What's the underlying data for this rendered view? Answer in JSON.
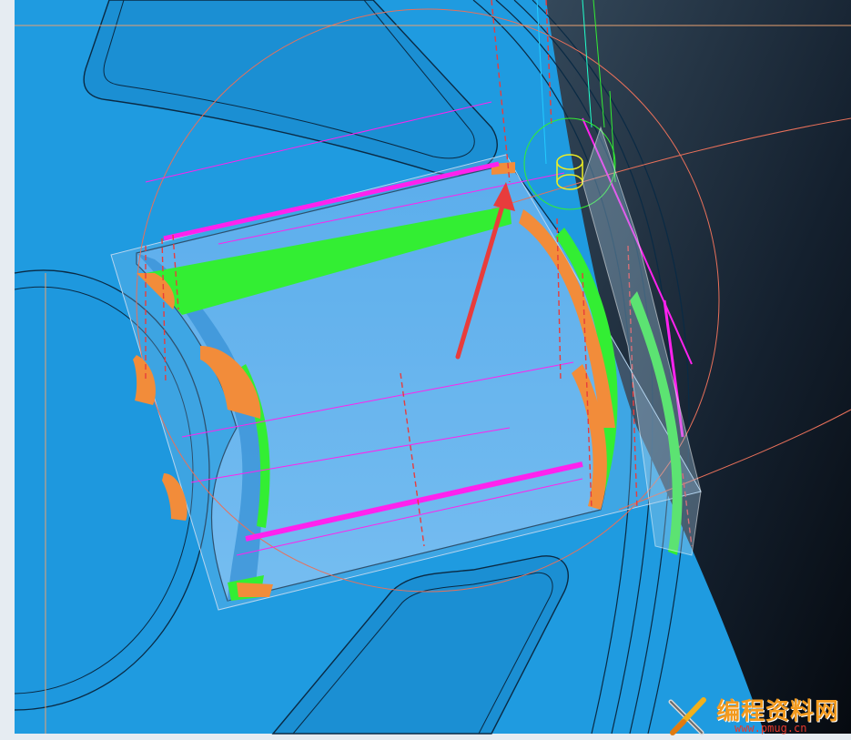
{
  "viewport": {
    "background": "#1f9be0",
    "background_dark": "#0b1320",
    "colors": {
      "toolpath_green": "#33ee33",
      "toolpath_magenta": "#ff22ee",
      "toolpath_orange": "#f28c3a",
      "construction_red": "#e83c3c",
      "pocket_fill": "#5aaeee",
      "guide_line": "#e8705a"
    }
  },
  "watermark": {
    "title": "编程资料网",
    "url": "www.pmug.cn",
    "icon": "wrench-screwdriver-icon"
  }
}
